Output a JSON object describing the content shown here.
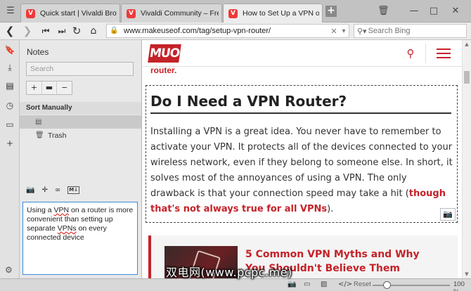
{
  "tabs": [
    {
      "title": "Quick start | Vivaldi Browser",
      "favicon": "vivaldi-icon"
    },
    {
      "title": "Vivaldi Community – Free w",
      "favicon": "vivaldi-icon"
    },
    {
      "title": "How to Set Up a VPN on You",
      "favicon": "vivaldi-icon"
    }
  ],
  "address": {
    "url": "www.makeuseof.com/tag/setup-vpn-router/",
    "search_placeholder": "Search Bing"
  },
  "notes_panel": {
    "title": "Notes",
    "search_placeholder": "Search",
    "sort_label": "Sort Manually",
    "items": [
      {
        "label": ""
      },
      {
        "label": "Trash"
      }
    ],
    "editor_text_before": "Using a ",
    "editor_vpn1": "VPN",
    "editor_text_mid": " on a router is more convenient than setting up separate ",
    "editor_vpn2": "VPNs",
    "editor_text_after": " on every connected device"
  },
  "page": {
    "logo": "MUO",
    "prev_tail": "router.",
    "heading": "Do I Need a VPN Router?",
    "body": "Installing a VPN is a great idea. You never have to remember to activate your VPN. It protects all of the devices connected to your wireless network, even if they belong to someone else. In short, it solves most of the annoyances of using a VPN. The only drawback is that your connection speed may take a hit (",
    "body_link": "though that's not always true for all VPNs",
    "body_end": ").",
    "related_title": "5 Common VPN Myths and Why You Shouldn't Believe Them"
  },
  "status": {
    "reset_label": "Reset",
    "zoom": "100 %"
  },
  "watermark": "双电网(www.pcpc.me)",
  "colors": {
    "brand_red": "#c52229",
    "vivaldi_red": "#ef3939",
    "focus_blue": "#3b8ee0"
  }
}
